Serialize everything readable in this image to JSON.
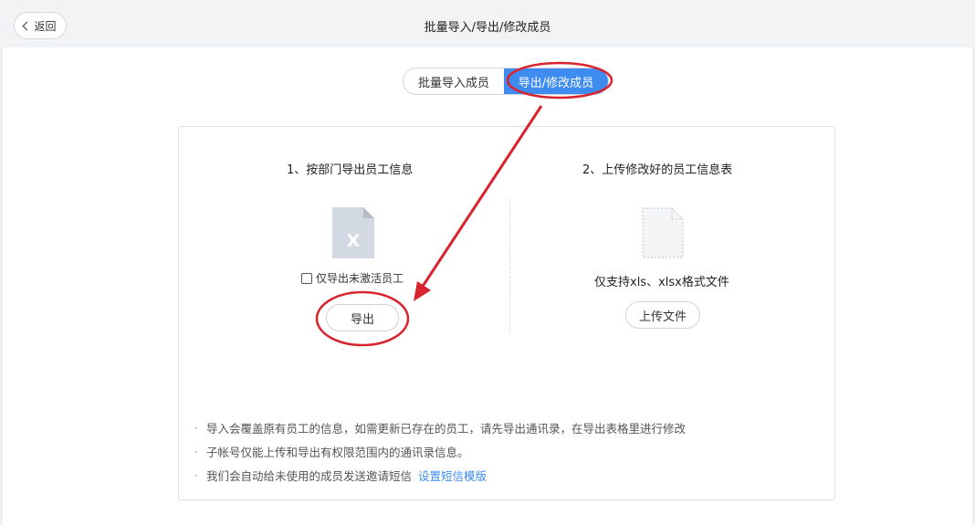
{
  "header": {
    "back_label": "返回",
    "title": "批量导入/导出/修改成员"
  },
  "tabs": [
    {
      "label": "批量导入成员",
      "active": false
    },
    {
      "label": "导出/修改成员",
      "active": true
    }
  ],
  "export_section": {
    "title": "1、按部门导出员工信息",
    "file_icon_glyph": "X",
    "checkbox_label": "仅导出未激活员工",
    "checkbox_checked": false,
    "button_label": "导出"
  },
  "upload_section": {
    "title": "2、上传修改好的员工信息表",
    "support_text": "仅支持xls、xlsx格式文件",
    "button_label": "上传文件"
  },
  "notes": [
    {
      "text": "导入会覆盖原有员工的信息，如需更新已存在的员工，请先导出通讯录，在导出表格里进行修改"
    },
    {
      "text": "子帐号仅能上传和导出有权限范围内的通讯录信息。"
    },
    {
      "text": "我们会自动给未使用的成员发送邀请短信",
      "link": "设置短信模版"
    }
  ],
  "colors": {
    "accent": "#3f8cf0",
    "annotation": "#d9232d",
    "topbar": "#f2f3f5"
  }
}
